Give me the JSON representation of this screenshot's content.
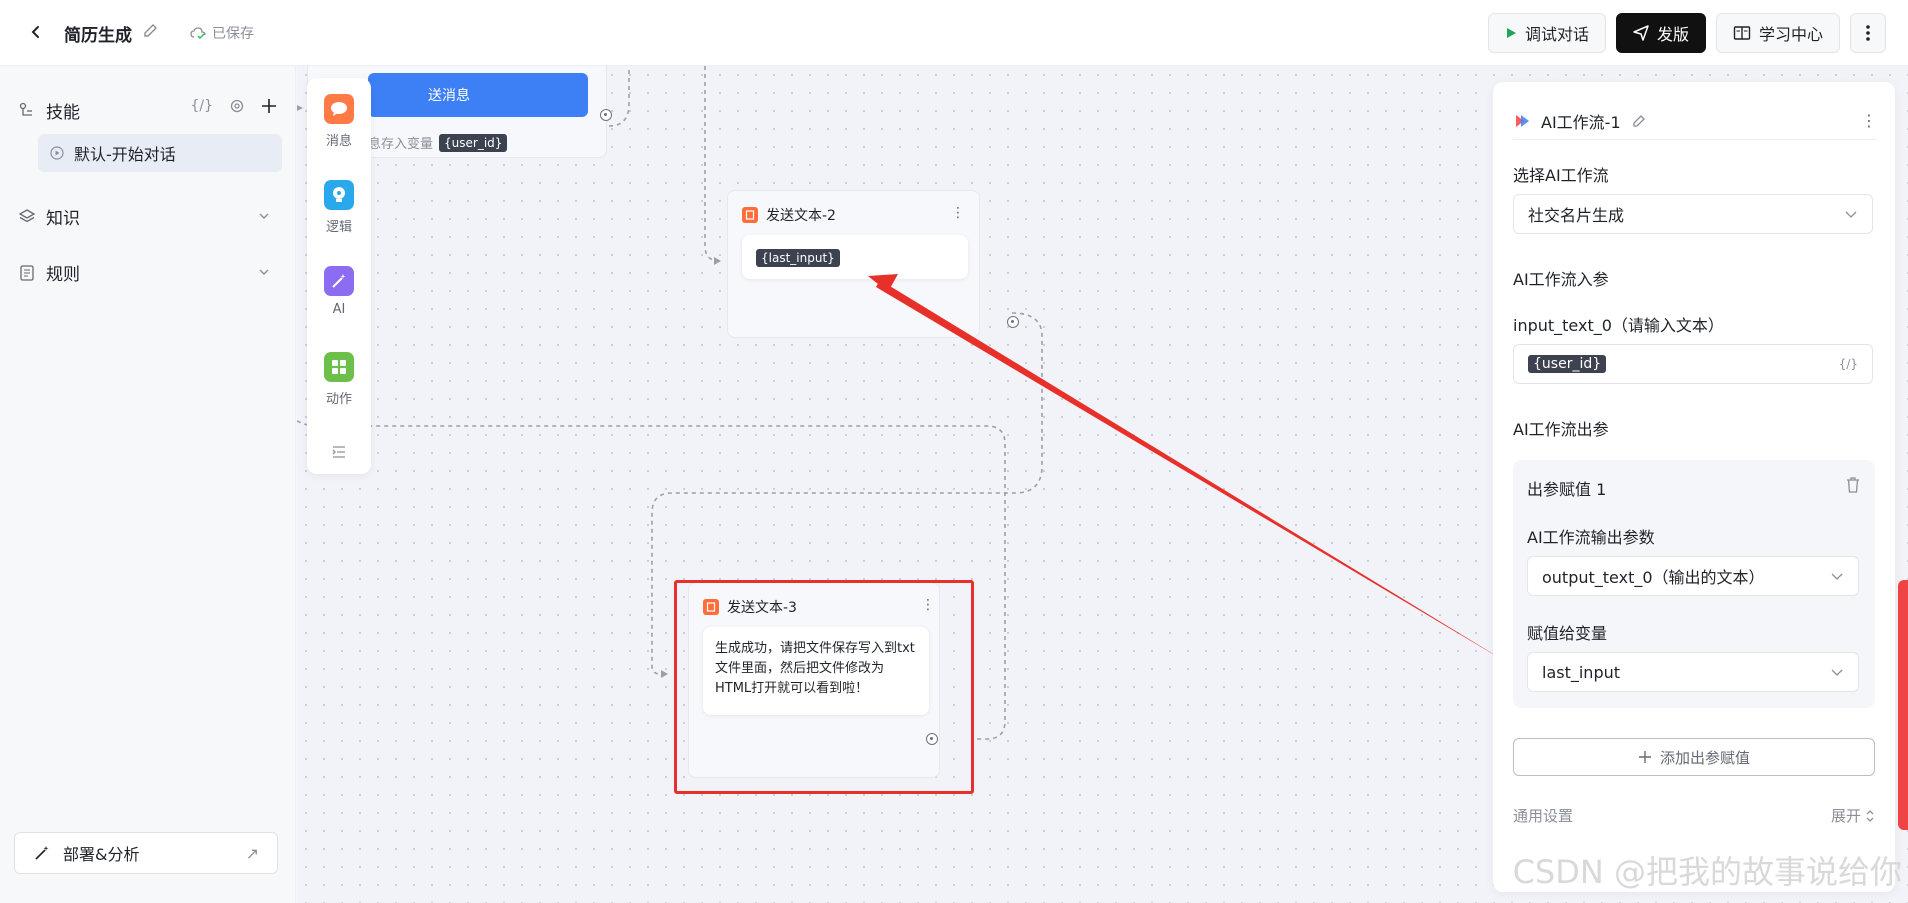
{
  "header": {
    "title": "简历生成",
    "saved_label": "已保存",
    "debug_label": "调试对话",
    "publish_label": "发版",
    "learn_label": "学习中心"
  },
  "sidebar": {
    "skills_label": "技能",
    "skills_var_icon": "{/}",
    "skill_item": "默认-开始对话",
    "knowledge_label": "知识",
    "rules_label": "规则",
    "deploy_label": "部署&分析"
  },
  "palette": {
    "items": [
      "消息",
      "逻辑",
      "AI",
      "动作"
    ]
  },
  "canvas": {
    "partial_node": {
      "button_label": "送消息",
      "text": "息存入变量",
      "var": "{user_id}"
    },
    "node2": {
      "title": "发送文本-2",
      "var": "{last_input}"
    },
    "node3": {
      "title": "发送文本-3",
      "text": "生成成功，请把文件保存写入到txt文件里面，然后把文件修改为HTML打开就可以看到啦！"
    }
  },
  "panel": {
    "title": "AI工作流-1",
    "select_label": "选择AI工作流",
    "select_value": "社交名片生成",
    "input_section": "AI工作流入参",
    "input_param": "input_text_0（请输入文本）",
    "input_var": "{user_id}",
    "input_var_icon": "{/}",
    "output_section": "AI工作流出参",
    "output_card": {
      "title": "出参赋值 1",
      "param_label": "AI工作流输出参数",
      "param_value": "output_text_0（输出的文本）",
      "assign_label": "赋值给变量",
      "assign_value": "last_input"
    },
    "add_output_label": "添加出参赋值",
    "general_label": "通用设置",
    "expand_label": "展开"
  },
  "watermark": "CSDN @把我的故事说给你",
  "colors": {
    "accent_blue": "#3d7ff5",
    "node_orange": "#ff6d3b",
    "highlight_red": "#e8302b",
    "palette_message": "#ff7a45",
    "palette_logic": "#2aa8ec",
    "palette_ai": "#8c6cf0",
    "palette_action": "#6cc04a"
  }
}
